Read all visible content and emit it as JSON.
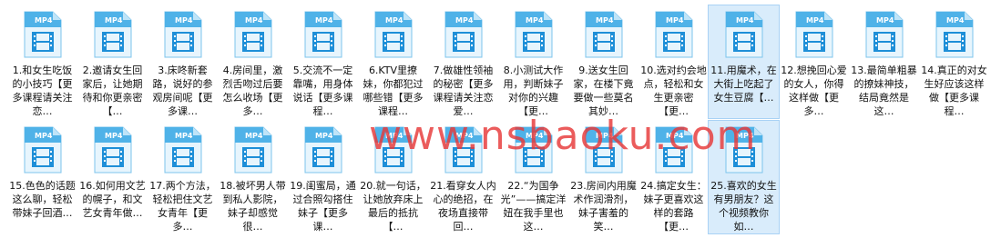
{
  "icon_badge": "MP4",
  "colors": {
    "icon_top": "#4fb2e8",
    "icon_body": "#e7f5fd",
    "icon_accent": "#1e8fd8",
    "selection": "#d9ecfb",
    "watermark": "#e73838"
  },
  "watermark": "www.nsbaoku.com",
  "files": [
    {
      "label": "1.和女生吃饭的小技巧【更多课程请关注恋…"
    },
    {
      "label": "2.邀请女生回家后，让她期待和你更亲密【…"
    },
    {
      "label": "3.床咚新套路，说好的参观房间呢【更多课…"
    },
    {
      "label": "4.房间里，激烈舌吻过后要怎么收场【更多…"
    },
    {
      "label": "5.交流不一定靠嘴，用身体说话【更多课程…"
    },
    {
      "label": "6.KTV里撩妹，你都犯过哪些错【更多课程…"
    },
    {
      "label": "7.做雄性领袖的秘密【更多课程请关注恋爱…"
    },
    {
      "label": "8.小测试大作用，判断妹子对你的兴趣【更…"
    },
    {
      "label": "9.送女生回家，在楼下竟要做一些莫名其妙…"
    },
    {
      "label": "10.选对约会地点，轻松和女生更亲密【更…"
    },
    {
      "label": "11.用魔术，在大街上吃起了女生豆腐【…",
      "selected": true
    },
    {
      "label": "12.想挽回心爱的女人，你得这样做【更多…"
    },
    {
      "label": "13.最简单粗暴的撩妹神技，结局竟然是这…"
    },
    {
      "label": "14.真正的对女生好应该这样做【更多课程…"
    },
    {
      "label": "15.色色的话题这么聊，轻松带妹子回酒…"
    },
    {
      "label": "16.如何用文艺的幌子，和文艺女青年做…"
    },
    {
      "label": "17.两个方法，轻松把住文艺女青年【更多…"
    },
    {
      "label": "18.被坏男人带到私人影院，妹子却感觉很…"
    },
    {
      "label": "19.闺蜜局，通过合照勾搭住妹子【更多课…"
    },
    {
      "label": "20.就一句话，让她放弃床上最后的抵抗【…"
    },
    {
      "label": "21.看穿女人内心的绝招，在夜场直接带回…"
    },
    {
      "label": "22.“为国争光”——搞定洋妞在我手里也这…"
    },
    {
      "label": "23.房间内用魔术作润滑剂，妹子害羞的笑…"
    },
    {
      "label": "24.搞定女生：妹子更喜欢这样的套路【更…"
    },
    {
      "label": "25.喜欢的女生有男朋友？这个视频教你如…",
      "selected": true
    }
  ]
}
